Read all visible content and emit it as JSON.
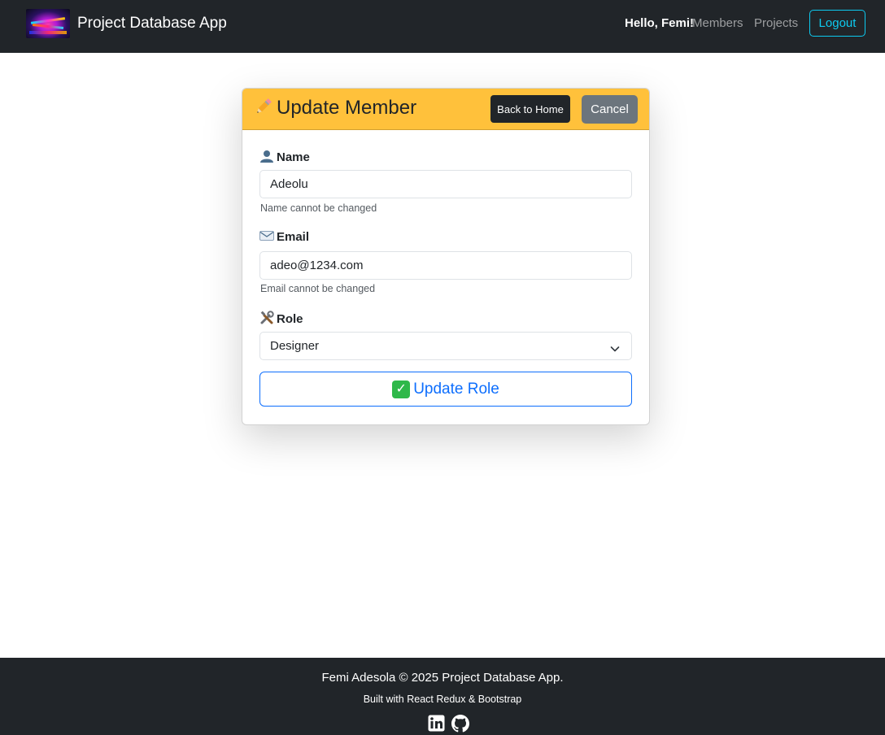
{
  "navbar": {
    "brand": "Project Database App",
    "greeting": "Hello, Femi!",
    "links": [
      "Members",
      "Projects"
    ],
    "logout_label": "Logout"
  },
  "card": {
    "title": "Update Member",
    "title_icon": "pencil-icon",
    "back_label": "Back to Home",
    "cancel_label": "Cancel",
    "header_color": "#ffc13b"
  },
  "form": {
    "name": {
      "label": "Name",
      "icon": "user-icon",
      "value": "Adeolu",
      "help": "Name cannot be changed"
    },
    "email": {
      "label": "Email",
      "icon": "email-icon",
      "value": "adeo@1234.com",
      "help": "Email cannot be changed"
    },
    "role": {
      "label": "Role",
      "icon": "tools-icon",
      "selected": "Designer"
    },
    "submit_label": "Update Role",
    "submit_icon": "check-icon"
  },
  "footer": {
    "copyright": "Femi Adesola © 2025 Project Database App.",
    "tagline": "Built with React Redux & Bootstrap",
    "icons": [
      "linkedin-icon",
      "github-icon"
    ]
  },
  "colors": {
    "navbar_bg": "#212529",
    "accent_info": "#0dcaf0",
    "primary": "#0d6efd",
    "secondary": "#6c757d"
  }
}
